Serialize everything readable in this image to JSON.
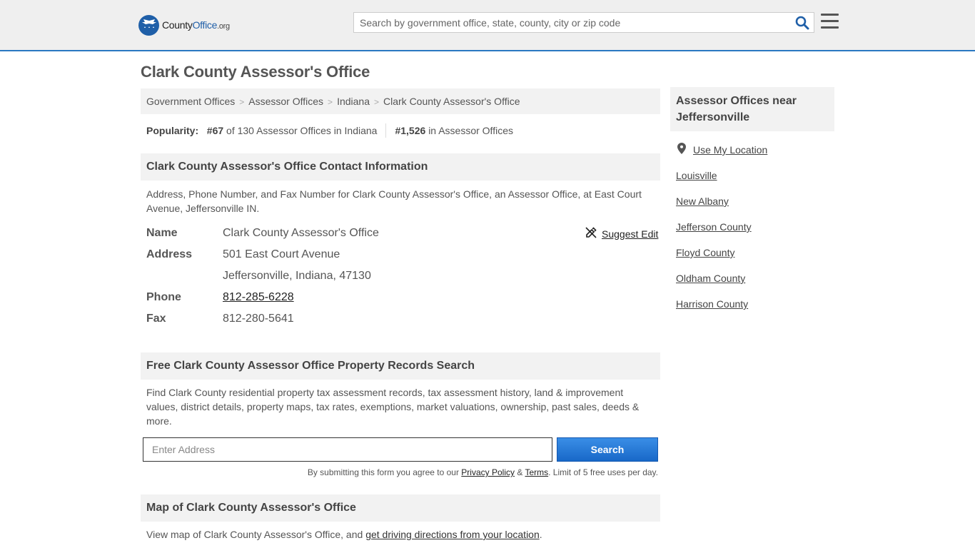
{
  "header": {
    "logo_county": "County",
    "logo_office": "Office",
    "logo_org": ".org",
    "search_placeholder": "Search by government office, state, county, city or zip code"
  },
  "page_title": "Clark County Assessor's Office",
  "breadcrumbs": [
    {
      "label": "Government Offices"
    },
    {
      "label": "Assessor Offices"
    },
    {
      "label": "Indiana"
    },
    {
      "label": "Clark County Assessor's Office"
    }
  ],
  "breadcrumb_separator": ">",
  "popularity": {
    "label": "Popularity:",
    "rank_state": "#67",
    "rank_state_text": "of 130 Assessor Offices in Indiana",
    "rank_national": "#1,526",
    "rank_national_text": "in Assessor Offices"
  },
  "contact": {
    "heading": "Clark County Assessor's Office Contact Information",
    "description": "Address, Phone Number, and Fax Number for Clark County Assessor's Office, an Assessor Office, at East Court Avenue, Jeffersonville IN.",
    "suggest_edit": "Suggest Edit",
    "name_label": "Name",
    "name_value": "Clark County Assessor's Office",
    "address_label": "Address",
    "address_line1": "501 East Court Avenue",
    "address_line2": "Jeffersonville, Indiana, 47130",
    "phone_label": "Phone",
    "phone_value": "812-285-6228",
    "fax_label": "Fax",
    "fax_value": "812-280-5641"
  },
  "records": {
    "heading": "Free Clark County Assessor Office Property Records Search",
    "description": "Find Clark County residential property tax assessment records, tax assessment history, land & improvement values, district details, property maps, tax rates, exemptions, market valuations, ownership, past sales, deeds & more.",
    "address_placeholder": "Enter Address",
    "search_button": "Search",
    "disclaimer_prefix": "By submitting this form you agree to our",
    "privacy_link": "Privacy Policy",
    "amp": "&",
    "terms_link": "Terms",
    "disclaimer_suffix": ". Limit of 5 free uses per day."
  },
  "map": {
    "heading": "Map of Clark County Assessor's Office",
    "description_prefix": "View map of Clark County Assessor's Office, and",
    "directions_link": "get driving directions from your location",
    "description_suffix": "."
  },
  "sidebar": {
    "heading": "Assessor Offices near Jeffersonville",
    "use_location": "Use My Location",
    "items": [
      {
        "label": "Louisville"
      },
      {
        "label": "New Albany"
      },
      {
        "label": "Jefferson County"
      },
      {
        "label": "Floyd County"
      },
      {
        "label": "Oldham County"
      },
      {
        "label": "Harrison County"
      }
    ]
  },
  "colors": {
    "accent_blue": "#2a78c2",
    "button_blue": "#1868c8",
    "panel_gray": "#f2f2f2"
  },
  "icons": [
    "search-icon",
    "menu-icon",
    "suggest-edit-icon",
    "location-pin-icon",
    "logo-eagle-icon"
  ]
}
